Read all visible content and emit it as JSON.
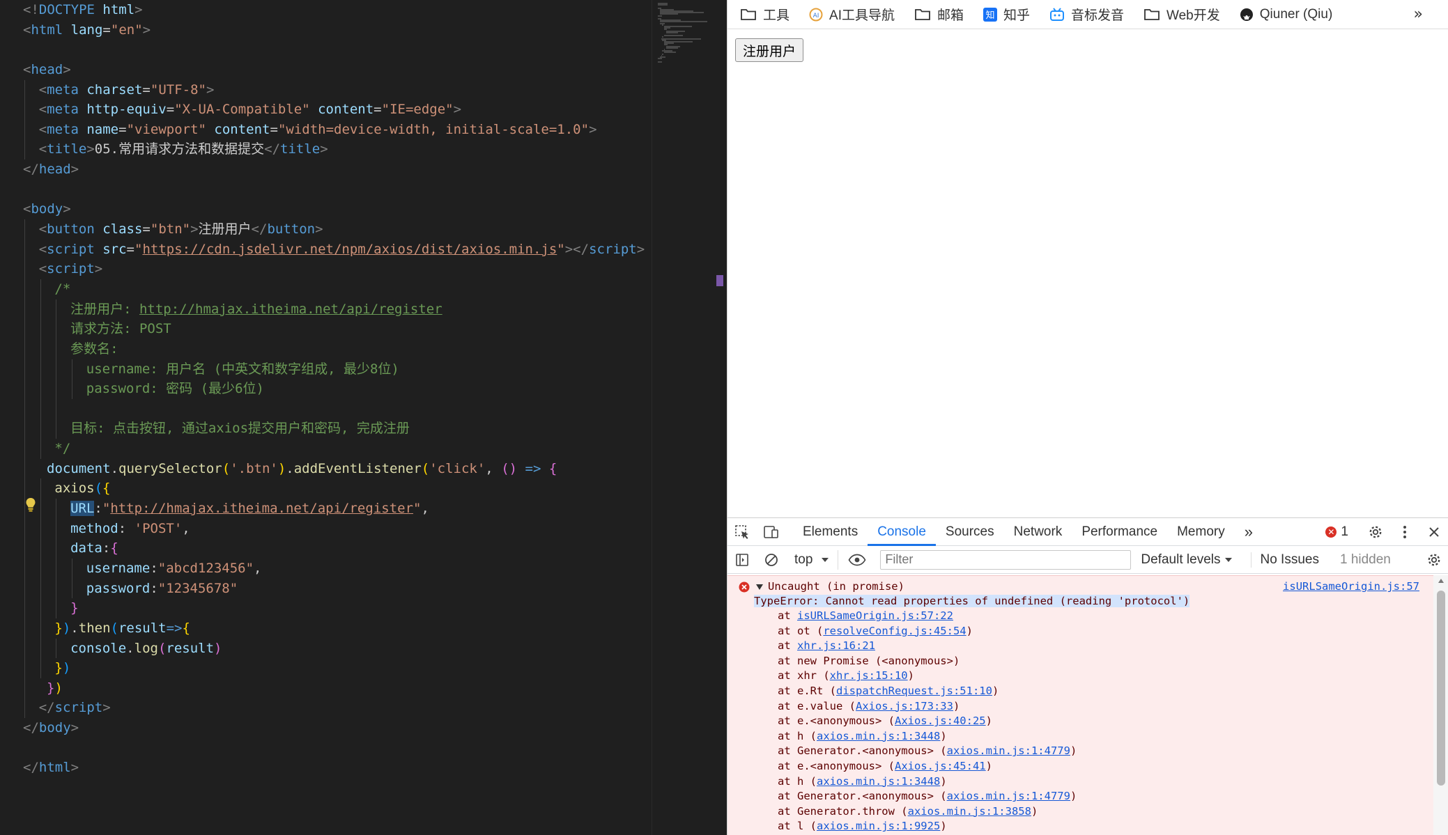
{
  "editor": {
    "lines": [
      {
        "indent": 0,
        "tokens": [
          [
            "t-br",
            "<!"
          ],
          [
            "t-tag",
            "DOCTYPE "
          ],
          [
            "t-attr",
            "html"
          ],
          [
            "t-br",
            ">"
          ]
        ]
      },
      {
        "indent": 0,
        "tokens": [
          [
            "t-br",
            "<"
          ],
          [
            "t-tag",
            "html "
          ],
          [
            "t-attr",
            "lang"
          ],
          [
            "t-pn",
            "="
          ],
          [
            "t-str",
            "\"en\""
          ],
          [
            "t-br",
            ">"
          ]
        ]
      },
      {
        "indent": 0,
        "tokens": []
      },
      {
        "indent": 0,
        "tokens": [
          [
            "t-br",
            "<"
          ],
          [
            "t-tag",
            "head"
          ],
          [
            "t-br",
            ">"
          ]
        ]
      },
      {
        "indent": 1,
        "tokens": [
          [
            "t-br",
            "<"
          ],
          [
            "t-tag",
            "meta "
          ],
          [
            "t-attr",
            "charset"
          ],
          [
            "t-pn",
            "="
          ],
          [
            "t-str",
            "\"UTF-8\""
          ],
          [
            "t-br",
            ">"
          ]
        ]
      },
      {
        "indent": 1,
        "tokens": [
          [
            "t-br",
            "<"
          ],
          [
            "t-tag",
            "meta "
          ],
          [
            "t-attr",
            "http-equiv"
          ],
          [
            "t-pn",
            "="
          ],
          [
            "t-str",
            "\"X-UA-Compatible\" "
          ],
          [
            "t-attr",
            "content"
          ],
          [
            "t-pn",
            "="
          ],
          [
            "t-str",
            "\"IE=edge\""
          ],
          [
            "t-br",
            ">"
          ]
        ]
      },
      {
        "indent": 1,
        "tokens": [
          [
            "t-br",
            "<"
          ],
          [
            "t-tag",
            "meta "
          ],
          [
            "t-attr",
            "name"
          ],
          [
            "t-pn",
            "="
          ],
          [
            "t-str",
            "\"viewport\" "
          ],
          [
            "t-attr",
            "content"
          ],
          [
            "t-pn",
            "="
          ],
          [
            "t-str",
            "\"width=device-width, initial-scale=1.0\""
          ],
          [
            "t-br",
            ">"
          ]
        ]
      },
      {
        "indent": 1,
        "tokens": [
          [
            "t-br",
            "<"
          ],
          [
            "t-tag",
            "title"
          ],
          [
            "t-br",
            ">"
          ],
          [
            "t-pn",
            "05.常用请求方法和数据提交"
          ],
          [
            "t-br",
            "</"
          ],
          [
            "t-tag",
            "title"
          ],
          [
            "t-br",
            ">"
          ]
        ]
      },
      {
        "indent": 0,
        "tokens": [
          [
            "t-br",
            "</"
          ],
          [
            "t-tag",
            "head"
          ],
          [
            "t-br",
            ">"
          ]
        ]
      },
      {
        "indent": 0,
        "tokens": []
      },
      {
        "indent": 0,
        "tokens": [
          [
            "t-br",
            "<"
          ],
          [
            "t-tag",
            "body"
          ],
          [
            "t-br",
            ">"
          ]
        ]
      },
      {
        "indent": 1,
        "tokens": [
          [
            "t-br",
            "<"
          ],
          [
            "t-tag",
            "button "
          ],
          [
            "t-attr",
            "class"
          ],
          [
            "t-pn",
            "="
          ],
          [
            "t-str",
            "\"btn\""
          ],
          [
            "t-br",
            ">"
          ],
          [
            "t-pn",
            "注册用户"
          ],
          [
            "t-br",
            "</"
          ],
          [
            "t-tag",
            "button"
          ],
          [
            "t-br",
            ">"
          ]
        ]
      },
      {
        "indent": 1,
        "tokens": [
          [
            "t-br",
            "<"
          ],
          [
            "t-tag",
            "script "
          ],
          [
            "t-attr",
            "src"
          ],
          [
            "t-pn",
            "="
          ],
          [
            "t-str",
            "\""
          ],
          [
            "t-str t-url",
            "https://cdn.jsdelivr.net/npm/axios/dist/axios.min.js"
          ],
          [
            "t-str",
            "\""
          ],
          [
            "t-br",
            "></"
          ],
          [
            "t-tag",
            "script"
          ],
          [
            "t-br",
            ">"
          ]
        ]
      },
      {
        "indent": 1,
        "tokens": [
          [
            "t-br",
            "<"
          ],
          [
            "t-tag",
            "script"
          ],
          [
            "t-br",
            ">"
          ]
        ]
      },
      {
        "indent": 2,
        "tokens": [
          [
            "t-cm",
            "/*"
          ]
        ]
      },
      {
        "indent": 3,
        "tokens": [
          [
            "t-cm",
            "注册用户: "
          ],
          [
            "t-cm t-url",
            "http://hmajax.itheima.net/api/register"
          ]
        ]
      },
      {
        "indent": 3,
        "tokens": [
          [
            "t-cm",
            "请求方法: POST"
          ]
        ]
      },
      {
        "indent": 3,
        "tokens": [
          [
            "t-cm",
            "参数名:"
          ]
        ]
      },
      {
        "indent": 4,
        "tokens": [
          [
            "t-cm",
            "username: 用户名 (中英文和数字组成, 最少8位)"
          ]
        ]
      },
      {
        "indent": 4,
        "tokens": [
          [
            "t-cm",
            "password: 密码 (最少6位)"
          ]
        ]
      },
      {
        "indent": 3,
        "tokens": []
      },
      {
        "indent": 3,
        "tokens": [
          [
            "t-cm",
            "目标: 点击按钮, 通过axios提交用户和密码, 完成注册"
          ]
        ]
      },
      {
        "indent": 2,
        "tokens": [
          [
            "t-cm",
            "*/"
          ]
        ]
      },
      {
        "indent": 1.5,
        "tokens": [
          [
            "t-attr",
            "document"
          ],
          [
            "t-pn",
            "."
          ],
          [
            "t-fn",
            "querySelector"
          ],
          [
            "t-b1",
            "("
          ],
          [
            "t-str",
            "'.btn'"
          ],
          [
            "t-b1",
            ")"
          ],
          [
            "t-pn",
            "."
          ],
          [
            "t-fn",
            "addEventListener"
          ],
          [
            "t-b1",
            "("
          ],
          [
            "t-str",
            "'click'"
          ],
          [
            "t-pn",
            ", "
          ],
          [
            "t-b2",
            "()"
          ],
          [
            "t-kw",
            " =>"
          ],
          [
            "t-pn",
            " "
          ],
          [
            "t-b2",
            "{"
          ]
        ]
      },
      {
        "indent": 2,
        "tokens": [
          [
            "t-fn",
            "axios"
          ],
          [
            "t-b3",
            "("
          ],
          [
            "t-b1",
            "{"
          ]
        ]
      },
      {
        "indent": 3,
        "tokens": [
          [
            "t-attr t-sel",
            "URL"
          ],
          [
            "t-pn",
            ":"
          ],
          [
            "t-str",
            "\""
          ],
          [
            "t-str t-url",
            "http://hmajax.itheima.net/api/register"
          ],
          [
            "t-str",
            "\""
          ],
          [
            "t-pn",
            ","
          ]
        ]
      },
      {
        "indent": 3,
        "tokens": [
          [
            "t-attr",
            "method"
          ],
          [
            "t-pn",
            ": "
          ],
          [
            "t-str",
            "'POST'"
          ],
          [
            "t-pn",
            ","
          ]
        ]
      },
      {
        "indent": 3,
        "tokens": [
          [
            "t-attr",
            "data"
          ],
          [
            "t-pn",
            ":"
          ],
          [
            "t-b2",
            "{"
          ]
        ]
      },
      {
        "indent": 4,
        "tokens": [
          [
            "t-attr",
            "username"
          ],
          [
            "t-pn",
            ":"
          ],
          [
            "t-str",
            "\"abcd123456\""
          ],
          [
            "t-pn",
            ","
          ]
        ]
      },
      {
        "indent": 4,
        "tokens": [
          [
            "t-attr",
            "password"
          ],
          [
            "t-pn",
            ":"
          ],
          [
            "t-str",
            "\"12345678\""
          ]
        ]
      },
      {
        "indent": 3,
        "tokens": [
          [
            "t-b2",
            "}"
          ]
        ]
      },
      {
        "indent": 2,
        "tokens": [
          [
            "t-b1",
            "}"
          ],
          [
            "t-b3",
            ")"
          ],
          [
            "t-pn",
            "."
          ],
          [
            "t-fn",
            "then"
          ],
          [
            "t-b3",
            "("
          ],
          [
            "t-attr",
            "result"
          ],
          [
            "t-kw",
            "=>"
          ],
          [
            "t-b1",
            "{"
          ]
        ]
      },
      {
        "indent": 3,
        "tokens": [
          [
            "t-attr",
            "console"
          ],
          [
            "t-pn",
            "."
          ],
          [
            "t-fn",
            "log"
          ],
          [
            "t-b2",
            "("
          ],
          [
            "t-attr",
            "result"
          ],
          [
            "t-b2",
            ")"
          ]
        ]
      },
      {
        "indent": 2,
        "tokens": [
          [
            "t-b1",
            "}"
          ],
          [
            "t-b3",
            ")"
          ]
        ]
      },
      {
        "indent": 1.5,
        "tokens": [
          [
            "t-b2",
            "}"
          ],
          [
            "t-b1",
            ")"
          ]
        ]
      },
      {
        "indent": 1,
        "tokens": [
          [
            "t-br",
            "</"
          ],
          [
            "t-tag",
            "script"
          ],
          [
            "t-br",
            ">"
          ]
        ]
      },
      {
        "indent": 0,
        "tokens": [
          [
            "t-br",
            "</"
          ],
          [
            "t-tag",
            "body"
          ],
          [
            "t-br",
            ">"
          ]
        ]
      },
      {
        "indent": 0,
        "tokens": []
      },
      {
        "indent": 0,
        "tokens": [
          [
            "t-br",
            "</"
          ],
          [
            "t-tag",
            "html"
          ],
          [
            "t-br",
            ">"
          ]
        ]
      }
    ]
  },
  "bookmarks": {
    "items": [
      {
        "label": "工具",
        "icon": "folder-icon"
      },
      {
        "label": "AI工具导航",
        "icon": "ai-logo-icon"
      },
      {
        "label": "邮箱",
        "icon": "folder-icon"
      },
      {
        "label": "知乎",
        "icon": "zhihu-icon"
      },
      {
        "label": "音标发音",
        "icon": "bilibili-icon"
      },
      {
        "label": "Web开发",
        "icon": "folder-icon"
      },
      {
        "label": "Qiuner (Qiu)",
        "icon": "github-icon"
      }
    ],
    "more": "»"
  },
  "page": {
    "button_label": "注册用户"
  },
  "devtools": {
    "tabs": [
      "Elements",
      "Console",
      "Sources",
      "Network",
      "Performance",
      "Memory"
    ],
    "active_tab": "Console",
    "more_tabs": "»",
    "error_count": "1",
    "context": "top",
    "filter_placeholder": "Filter",
    "levels": "Default levels",
    "no_issues": "No Issues",
    "hidden": "1 hidden",
    "error": {
      "header": "Uncaught (in promise)",
      "header_link": "isURLSameOrigin.js:57",
      "message": "TypeError: Cannot read properties of undefined (reading 'protocol')",
      "stack": [
        {
          "prefix": "at ",
          "link": "isURLSameOrigin.js:57:22",
          "suffix": ""
        },
        {
          "prefix": "at ot (",
          "link": "resolveConfig.js:45:54",
          "suffix": ")"
        },
        {
          "prefix": "at ",
          "link": "xhr.js:16:21",
          "suffix": ""
        },
        {
          "prefix": "at new Promise (<anonymous>)",
          "link": "",
          "suffix": ""
        },
        {
          "prefix": "at xhr (",
          "link": "xhr.js:15:10",
          "suffix": ")"
        },
        {
          "prefix": "at e.Rt (",
          "link": "dispatchRequest.js:51:10",
          "suffix": ")"
        },
        {
          "prefix": "at e.value (",
          "link": "Axios.js:173:33",
          "suffix": ")"
        },
        {
          "prefix": "at e.<anonymous> (",
          "link": "Axios.js:40:25",
          "suffix": ")"
        },
        {
          "prefix": "at h (",
          "link": "axios.min.js:1:3448",
          "suffix": ")"
        },
        {
          "prefix": "at Generator.<anonymous> (",
          "link": "axios.min.js:1:4779",
          "suffix": ")"
        },
        {
          "prefix": "at e.<anonymous> (",
          "link": "Axios.js:45:41",
          "suffix": ")"
        },
        {
          "prefix": "at h (",
          "link": "axios.min.js:1:3448",
          "suffix": ")"
        },
        {
          "prefix": "at Generator.<anonymous> (",
          "link": "axios.min.js:1:4779",
          "suffix": ")"
        },
        {
          "prefix": "at Generator.throw (",
          "link": "axios.min.js:1:3858",
          "suffix": ")"
        },
        {
          "prefix": "at l (",
          "link": "axios.min.js:1:9925",
          "suffix": ")"
        }
      ]
    }
  },
  "colors": {
    "accent": "#1a73e8",
    "error": "#d93025",
    "editor_bg": "#1f1f1f"
  }
}
